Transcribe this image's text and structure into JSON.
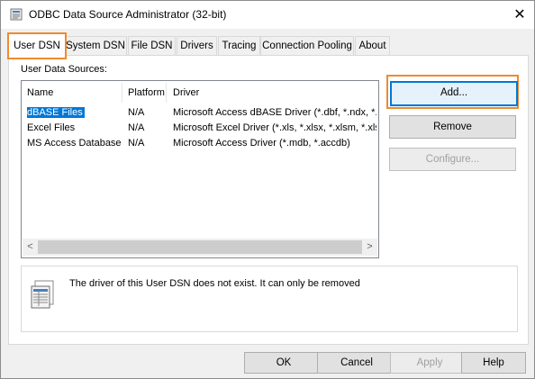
{
  "window": {
    "title": "ODBC Data Source Administrator (32-bit)",
    "close_glyph": "✕"
  },
  "tabs": [
    {
      "label": "User DSN",
      "active": true
    },
    {
      "label": "System DSN"
    },
    {
      "label": "File DSN"
    },
    {
      "label": "Drivers"
    },
    {
      "label": "Tracing"
    },
    {
      "label": "Connection Pooling"
    },
    {
      "label": "About"
    }
  ],
  "user_dsn": {
    "section_label": "User Data Sources:",
    "columns": [
      "Name",
      "Platform",
      "Driver"
    ],
    "rows": [
      {
        "name": "dBASE Files",
        "platform": "N/A",
        "driver": "Microsoft Access dBASE Driver (*.dbf, *.ndx, *.m",
        "selected": true
      },
      {
        "name": "Excel Files",
        "platform": "N/A",
        "driver": "Microsoft Excel Driver (*.xls, *.xlsx, *.xlsm, *.xlsb)"
      },
      {
        "name": "MS Access Database",
        "platform": "N/A",
        "driver": "Microsoft Access Driver (*.mdb, *.accdb)"
      }
    ],
    "buttons": {
      "add": "Add...",
      "remove": "Remove",
      "configure": "Configure..."
    },
    "description": "The driver of this User DSN does not exist. It can only be removed",
    "scroll_left": "<",
    "scroll_right": ">"
  },
  "footer": {
    "ok": "OK",
    "cancel": "Cancel",
    "apply": "Apply",
    "help": "Help"
  },
  "colors": {
    "highlight": "#f08a2c",
    "selection": "#0078d7"
  },
  "icons": [
    "odbc-app-icon",
    "close-icon",
    "datasource-document-icon"
  ]
}
